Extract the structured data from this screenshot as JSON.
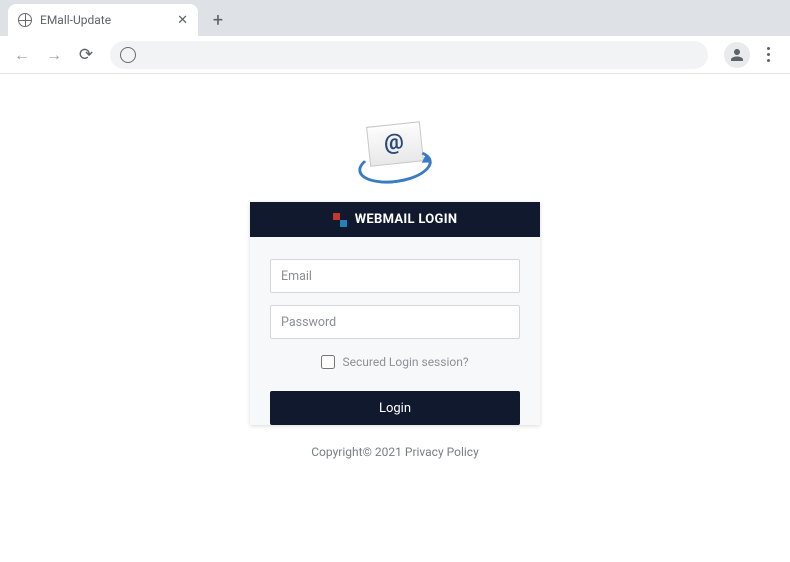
{
  "window": {
    "tab_title": "EMall-Update"
  },
  "login": {
    "header": "WEBMAIL LOGIN",
    "email_placeholder": "Email",
    "password_placeholder": "Password",
    "secured_label": "Secured Login session?",
    "login_button": "Login"
  },
  "footer": {
    "copyright": "Copyright© 2021 Privacy Policy"
  },
  "logo": {
    "at_symbol": "@"
  }
}
